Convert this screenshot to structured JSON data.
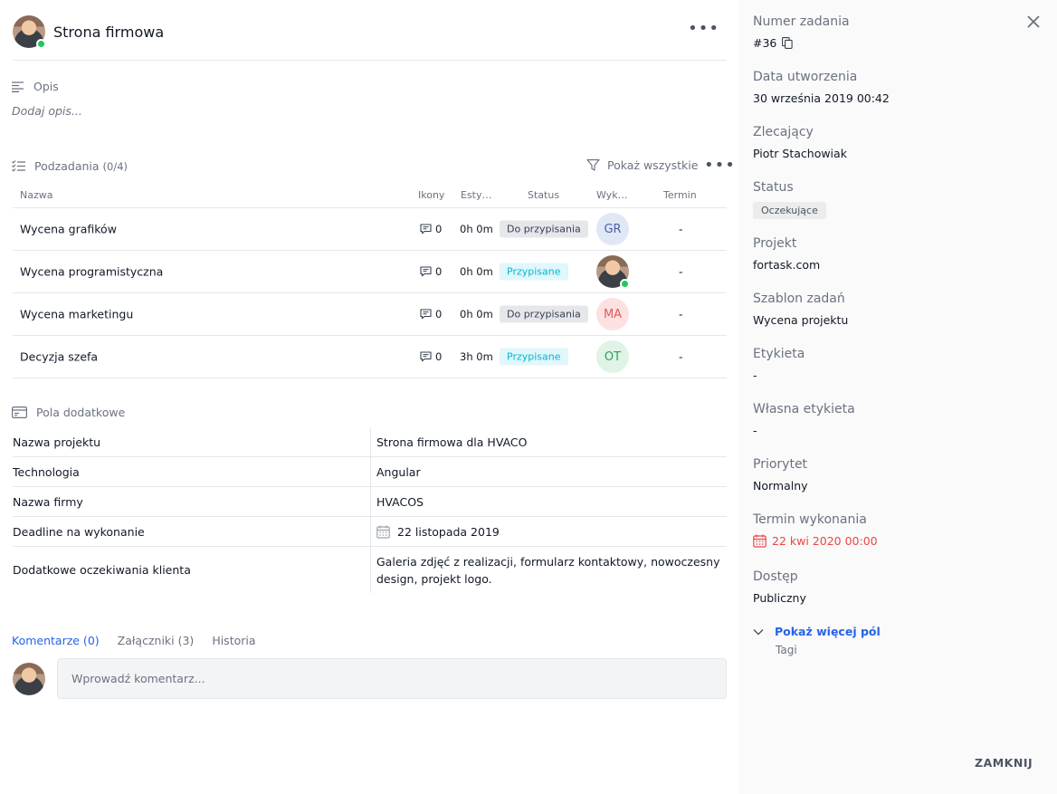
{
  "task": {
    "title": "Strona firmowa",
    "more_icon": "more-horizontal-icon"
  },
  "description": {
    "heading": "Opis",
    "placeholder": "Dodaj opis..."
  },
  "subtasks": {
    "heading": "Podzadania",
    "count": "(0/4)",
    "filter_label": "Pokaż wszystkie",
    "columns": [
      "Nazwa",
      "Ikony",
      "Esty…",
      "Status",
      "Wyk…",
      "Termin"
    ],
    "rows": [
      {
        "name": "Wycena grafików",
        "comments": "0",
        "estimate": "0h 0m",
        "status": "Do przypisania",
        "status_style": "gray",
        "assignee": "GR",
        "assignee_bg": "#e0e7f5",
        "assignee_fg": "#4a5fa8",
        "deadline": "-"
      },
      {
        "name": "Wycena programistyczna",
        "comments": "0",
        "estimate": "0h 0m",
        "status": "Przypisane",
        "status_style": "blue",
        "assignee": "",
        "assignee_photo": true,
        "deadline": "-"
      },
      {
        "name": "Wycena marketingu",
        "comments": "0",
        "estimate": "0h 0m",
        "status": "Do przypisania",
        "status_style": "gray",
        "assignee": "MA",
        "assignee_bg": "#fde1e1",
        "assignee_fg": "#e05b5b",
        "deadline": "-"
      },
      {
        "name": "Decyzja szefa",
        "comments": "0",
        "estimate": "3h 0m",
        "status": "Przypisane",
        "status_style": "blue",
        "assignee": "OT",
        "assignee_bg": "#dff3e6",
        "assignee_fg": "#2f9e5b",
        "deadline": "-"
      }
    ]
  },
  "extra_fields": {
    "heading": "Pola dodatkowe",
    "rows": [
      {
        "key": "Nazwa projektu",
        "value": "Strona firmowa dla HVACO"
      },
      {
        "key": "Technologia",
        "value": "Angular"
      },
      {
        "key": "Nazwa firmy",
        "value": "HVACOS"
      },
      {
        "key": "Deadline na wykonanie",
        "value": "22 listopada 2019",
        "icon": "calendar-icon"
      },
      {
        "key": "Dodatkowe oczekiwania klienta",
        "value": "Galeria zdjęć z realizacji, formularz kontaktowy, nowoczesny design, projekt logo."
      }
    ]
  },
  "tabs": [
    {
      "label": "Komentarze (0)",
      "active": true
    },
    {
      "label": "Załączniki (3)",
      "active": false
    },
    {
      "label": "Historia",
      "active": false
    }
  ],
  "comment": {
    "placeholder": "Wprowadź komentarz..."
  },
  "side": {
    "fields": [
      {
        "label": "Numer zadania",
        "value": "#36"
      },
      {
        "label": "Data utworzenia",
        "value": "30 września 2019 00:42"
      },
      {
        "label": "Zlecający",
        "value": "Piotr Stachowiak"
      },
      {
        "label": "Status",
        "value": "Oczekujące"
      },
      {
        "label": "Projekt",
        "value": "fortask.com"
      },
      {
        "label": "Szablon zadań",
        "value": "Wycena projektu"
      },
      {
        "label": "Etykieta",
        "value": "-"
      },
      {
        "label": "Własna etykieta",
        "value": "-"
      },
      {
        "label": "Priorytet",
        "value": "Normalny"
      },
      {
        "label": "Termin wykonania",
        "value": "22 kwi 2020 00:00"
      },
      {
        "label": "Dostęp",
        "value": "Publiczny"
      }
    ],
    "show_more": "Pokaż więcej pól",
    "tags": "Tagi",
    "close_label": "ZAMKNIJ"
  },
  "colors": {
    "accent": "#2563eb",
    "online": "#22c55e",
    "overdue": "#ef4444",
    "status_blue": "#06b6d4"
  }
}
